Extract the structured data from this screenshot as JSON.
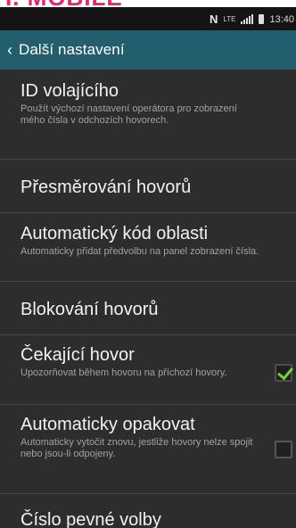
{
  "top_banner": {
    "text": "I. MOBILE"
  },
  "status_bar": {
    "nfc_icon": "nfc-n-icon",
    "network_type": "LTE",
    "time": "13:40"
  },
  "action_bar": {
    "title": "Další nastavení",
    "back_icon": "chevron-left-icon"
  },
  "settings": [
    {
      "title": "ID volajícího",
      "summary": "Použít výchozí nastavení operátora pro zobrazení mého čísla v odchozích hovorech."
    },
    {
      "title": "Přesměrování hovorů"
    },
    {
      "title": "Automatický kód oblasti",
      "summary": "Automaticky přidat předvolbu na panel zobrazení čísla."
    },
    {
      "title": "Blokování hovorů"
    },
    {
      "title": "Čekající hovor",
      "summary": "Upozorňovat během hovoru na příchozí hovory.",
      "checked": true
    },
    {
      "title": "Automaticky opakovat",
      "summary": "Automaticky vytočit znovu, jestliže hovory nelze spojit nebo jsou-li odpojeny.",
      "checked": false
    },
    {
      "title": "Číslo pevné volby"
    }
  ],
  "colors": {
    "background": "#2d2d2d",
    "action_bar": "#235e6f",
    "check_accent": "#6fd238",
    "banner_accent": "#e8246c"
  }
}
